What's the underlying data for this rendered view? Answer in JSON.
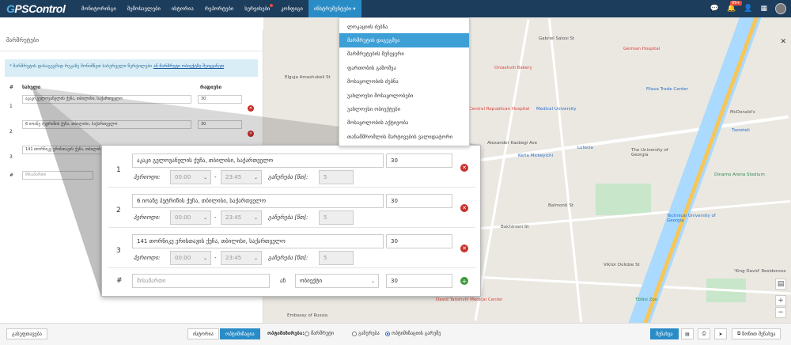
{
  "app": {
    "logo_g": "G",
    "logo_rest": "PSControl"
  },
  "nav": [
    {
      "label": "მონიტორინგი"
    },
    {
      "label": "შემოსავლები"
    },
    {
      "label": "ისტორია"
    },
    {
      "label": "რეპორტები"
    },
    {
      "label": "სერვისები"
    },
    {
      "label": "კონფიგი"
    },
    {
      "label": "ინსტრუმენტები ▾"
    }
  ],
  "top_icons": {
    "notifications_badge": "99+"
  },
  "dropdown": [
    "ლოკაციის ძებნა",
    "მარშრუტის დაგეგმვა",
    "მარშრუტების მენეჯერი",
    "ფართობის გაზომვა",
    "მოსაყოლობის ძებნა",
    "უახლოესი მოსაყოლობები",
    "უახლოესი ობიექტები",
    "მოსაყოლობის აქტივობა",
    "თანამშრომლის მარტივების ვალიდატორი"
  ],
  "panel": {
    "title": "მარშრუტები",
    "info_text": "* მარშრუტის დასაგეგმად რუკაზე მონიშნეთ სასურველი წერტილები ",
    "info_link": "ან მარშრუტი ობიექტზე შეიყვანეთ",
    "col_hash": "#",
    "col_address": "სახელი",
    "col_radius": "რადიუსი"
  },
  "stops": [
    {
      "num": "1",
      "address": "აკაკი გელოვანელის ქუჩა, თბილისი, საქართველო",
      "radius": "30",
      "from": "00:00",
      "to": "23:45",
      "duration": "5"
    },
    {
      "num": "2",
      "address": "6 იოანე პეტრიწის ქუჩა, თბილისი, საქართველო",
      "radius": "30",
      "from": "00:00",
      "to": "23:45",
      "duration": "5"
    },
    {
      "num": "3",
      "address": "141 თორნიკე ერისთავის ქუჩა, თბილისი, საქართველო",
      "radius": "30",
      "from": "00:00",
      "to": "23:45",
      "duration": "5"
    }
  ],
  "labels": {
    "period": "პერიოდი:",
    "duration": "გაჩერება [წთ]:",
    "dash": "-",
    "or": "ან"
  },
  "new_row": {
    "hash": "#",
    "address_placeholder": "მისამართი",
    "object_placeholder": "ობიექტი",
    "radius": "30"
  },
  "mini_new_row": {
    "hash": "#",
    "address_placeholder": "მისამართი"
  },
  "map_labels": {
    "german_hospital": "German Hospital",
    "oniashvili": "Oniashvili Bakery",
    "central_hospital": "Central Republican Hospital",
    "medical_univ": "Medical University",
    "alexander_st": "Alexander Kazbegi Ave",
    "lutecia": "Lutecia",
    "keria": "Keria Mickeyichi",
    "univ_georgia": "The University of Georgia",
    "dinamo": "Dinamo Arena Stadium",
    "technical_univ": "Technical University of Georgia",
    "dialysis": "'King David' Residences",
    "tatishvili": "David Tatishvili Medical Center",
    "embassy": "Embassy of Russia",
    "zoo": "Tbilisi Zoo",
    "mcdonalds": "McDonald's",
    "tsereteli": "Tsereteli",
    "fillava": "Filava Trade Center",
    "gabriel_st": "Gabriel Salosi St",
    "balmont": "Balmonti St",
    "bakhtrioni": "Bakhtrioni St",
    "vazha": "Viktor Dolidze St",
    "president": "President Heydar Aliyev Embankment",
    "elguja": "Elguja Amashukeli St"
  },
  "bottom": {
    "left_btn": "გასუფთავება",
    "history_btn": "ისტორია",
    "optimize_btn": "ოპტიმიზაცია",
    "opt_label": "ოპტიმიზირება:",
    "opt1": "მარშრუტი",
    "opt2": "გაჩერება",
    "opt3": "ოპტიმიზაციის გარეშე",
    "save_btn": "შენახვა",
    "route_send": "ზონით შენახვა"
  },
  "colors": {
    "topbar": "#1d3d5c",
    "accent": "#2a8cc7",
    "danger": "#c9302c",
    "success": "#3c9a3c"
  }
}
